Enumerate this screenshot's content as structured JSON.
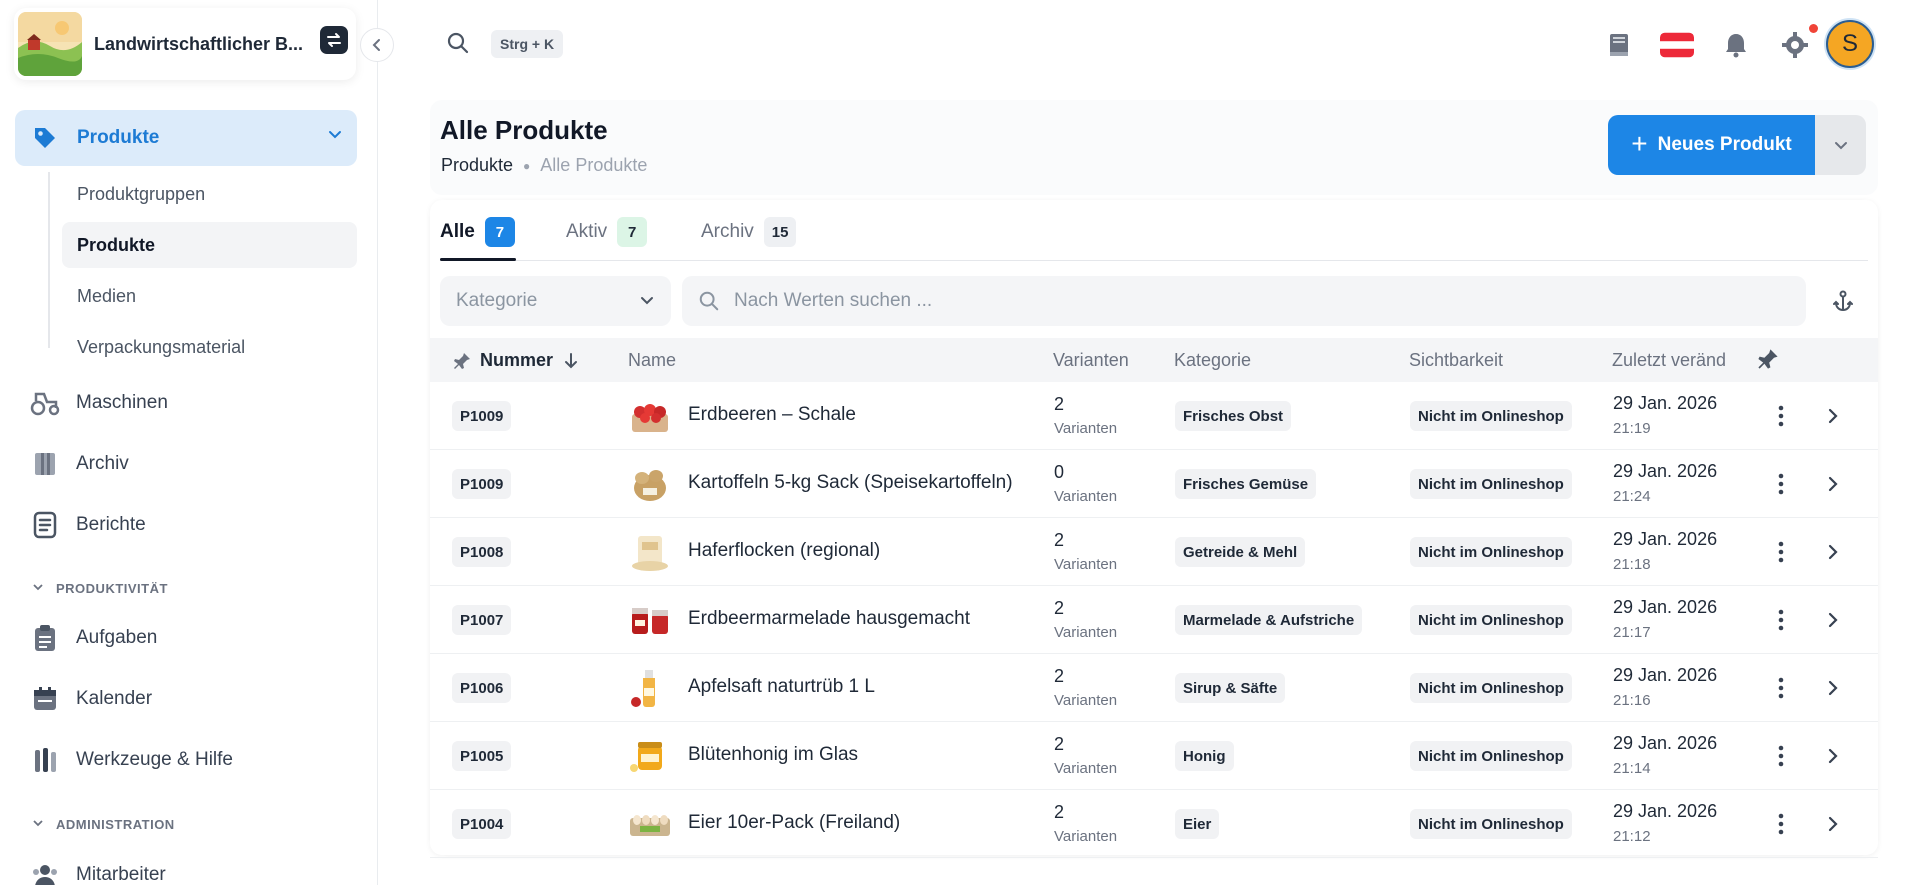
{
  "brand": {
    "name": "Landwirtschaftlicher B...",
    "switch_icon": "swap-icon"
  },
  "sidebar": {
    "active_item": {
      "label": "Produkte",
      "icon": "tag-icon"
    },
    "sub_items": [
      "Produktgruppen",
      "Produkte",
      "Medien",
      "Verpackungsmaterial"
    ],
    "selected_sub": "Produkte",
    "items": [
      {
        "label": "Maschinen",
        "icon": "tractor-icon"
      },
      {
        "label": "Archiv",
        "icon": "archive-icon"
      },
      {
        "label": "Berichte",
        "icon": "report-icon"
      }
    ],
    "section_productivity": "PRODUKTIVITÄT",
    "productivity_items": [
      {
        "label": "Aufgaben",
        "icon": "clipboard-icon"
      },
      {
        "label": "Kalender",
        "icon": "calendar-icon"
      },
      {
        "label": "Werkzeuge & Hilfe",
        "icon": "tools-icon"
      }
    ],
    "section_admin": "ADMINISTRATION",
    "admin_items": [
      {
        "label": "Mitarbeiter",
        "icon": "users-icon"
      }
    ]
  },
  "topbar": {
    "shortcut": "Strg + K",
    "avatar_initial": "S",
    "icons": [
      "book-icon",
      "austria-flag-icon",
      "bell-icon",
      "gear-icon"
    ]
  },
  "page": {
    "title": "Alle Produkte",
    "breadcrumb": [
      "Produkte",
      "Alle Produkte"
    ],
    "new_button": "Neues Produkt"
  },
  "tabs": [
    {
      "label": "Alle",
      "count": "7",
      "active": true,
      "badge_bg": "#1d86e6",
      "badge_fg": "#ffffff"
    },
    {
      "label": "Aktiv",
      "count": "7",
      "active": false,
      "badge_bg": "#dcf5e6",
      "badge_fg": "#1f2937"
    },
    {
      "label": "Archiv",
      "count": "15",
      "active": false,
      "badge_bg": "#eef0f3",
      "badge_fg": "#1f2937"
    }
  ],
  "filters": {
    "category_placeholder": "Kategorie",
    "search_placeholder": "Nach Werten suchen ..."
  },
  "table": {
    "columns": [
      "Nummer",
      "Name",
      "Varianten",
      "Kategorie",
      "Sichtbarkeit",
      "Zuletzt veränd"
    ],
    "variants_label": "Varianten",
    "rows": [
      {
        "number": "P1009",
        "name": "Erdbeeren – Schale",
        "variants": "2",
        "category": "Frisches Obst",
        "visibility": "Nicht im Onlineshop",
        "date": "29 Jan. 2026",
        "time": "21:19",
        "thumb": "strawberry"
      },
      {
        "number": "P1009",
        "name": "Kartoffeln 5-kg Sack (Speisekartoffeln)",
        "variants": "0",
        "category": "Frisches Gemüse",
        "visibility": "Nicht im Onlineshop",
        "date": "29 Jan. 2026",
        "time": "21:24",
        "thumb": "potato"
      },
      {
        "number": "P1008",
        "name": "Haferflocken (regional)",
        "variants": "2",
        "category": "Getreide & Mehl",
        "visibility": "Nicht im Onlineshop",
        "date": "29 Jan. 2026",
        "time": "21:18",
        "thumb": "oats"
      },
      {
        "number": "P1007",
        "name": "Erdbeermarmelade hausgemacht",
        "variants": "2",
        "category": "Marmelade & Aufstriche",
        "visibility": "Nicht im Onlineshop",
        "date": "29 Jan. 2026",
        "time": "21:17",
        "thumb": "jam"
      },
      {
        "number": "P1006",
        "name": "Apfelsaft naturtrüb 1 L",
        "variants": "2",
        "category": "Sirup & Säfte",
        "visibility": "Nicht im Onlineshop",
        "date": "29 Jan. 2026",
        "time": "21:16",
        "thumb": "juice"
      },
      {
        "number": "P1005",
        "name": "Blütenhonig im Glas",
        "variants": "2",
        "category": "Honig",
        "visibility": "Nicht im Onlineshop",
        "date": "29 Jan. 2026",
        "time": "21:14",
        "thumb": "honey"
      },
      {
        "number": "P1004",
        "name": "Eier 10er-Pack (Freiland)",
        "variants": "2",
        "category": "Eier",
        "visibility": "Nicht im Onlineshop",
        "date": "29 Jan. 2026",
        "time": "21:12",
        "thumb": "eggs"
      }
    ]
  }
}
